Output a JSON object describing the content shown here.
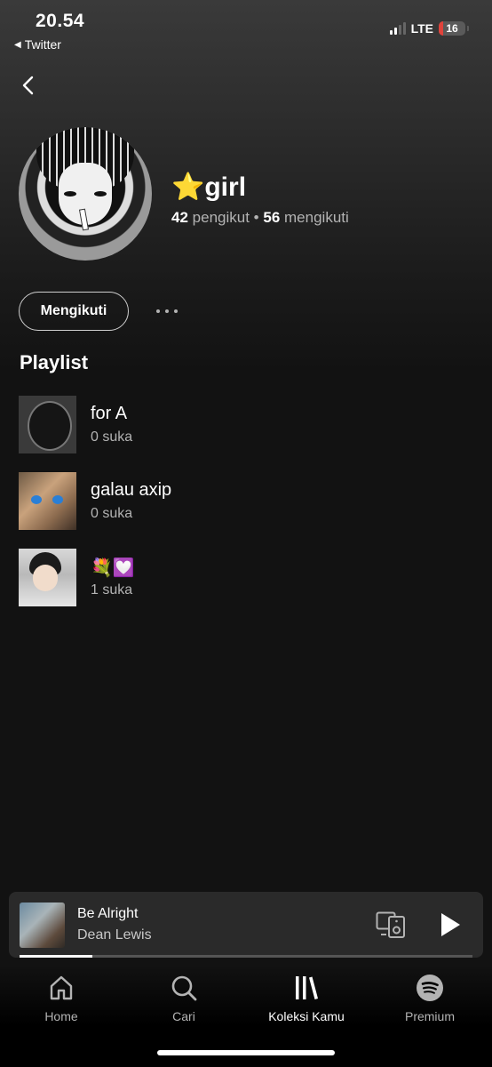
{
  "status_bar": {
    "time": "20.54",
    "back_app": "Twitter",
    "network": "LTE",
    "battery": "16",
    "battery_level": 0.16,
    "signal_bars": 2
  },
  "profile": {
    "name": "⭐girl",
    "followers_count": "42",
    "followers_label": "pengikut",
    "separator": "•",
    "following_count": "56",
    "following_label": "mengikuti",
    "follow_button_label": "Mengikuti"
  },
  "playlists": {
    "title": "Playlist",
    "items": [
      {
        "title": "for A",
        "likes": "0 suka"
      },
      {
        "title": "galau axip",
        "likes": "0 suka"
      },
      {
        "title": "💐💟",
        "likes": "1 suka"
      }
    ]
  },
  "mini_player": {
    "track": "Be Alright",
    "artist": "Dean Lewis",
    "progress": 0.16
  },
  "bottom_nav": {
    "items": [
      {
        "label": "Home",
        "icon": "home-icon"
      },
      {
        "label": "Cari",
        "icon": "search-icon"
      },
      {
        "label": "Koleksi Kamu",
        "icon": "library-icon",
        "active": true
      },
      {
        "label": "Premium",
        "icon": "spotify-icon"
      }
    ]
  },
  "colors": {
    "background": "#121212",
    "text_primary": "#ffffff",
    "text_secondary": "#b3b3b3",
    "battery_low": "#e0433b",
    "player_bg": "#2a2a2a"
  }
}
